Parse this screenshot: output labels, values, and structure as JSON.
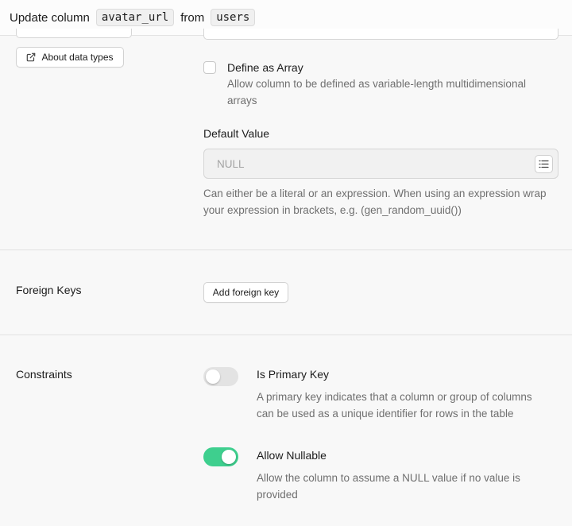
{
  "header": {
    "prefix": "Update column",
    "column": "avatar_url",
    "middle": "from",
    "table": "users"
  },
  "data_types": {
    "about_label": "About data types",
    "about_icon": "external-link-icon"
  },
  "array": {
    "label": "Define as Array",
    "description_line1": "Allow column to be defined as variable-length multidimensional",
    "description_line2": "arrays",
    "checked": false
  },
  "default_value": {
    "label": "Default Value",
    "placeholder": "NULL",
    "list_icon": "list-icon",
    "help_line1": "Can either be a literal or an expression. When using an expression wrap",
    "help_line2": "your expression in brackets, e.g. (gen_random_uuid())"
  },
  "foreign_keys": {
    "title": "Foreign Keys",
    "add_label": "Add foreign key"
  },
  "constraints": {
    "title": "Constraints",
    "primary_key": {
      "label": "Is Primary Key",
      "description_line1": "A primary key indicates that a column or group of columns",
      "description_line2": "can be used as a unique identifier for rows in the table",
      "enabled": false
    },
    "nullable": {
      "label": "Allow Nullable",
      "description_line1": "Allow the column to assume a NULL value if no value is",
      "description_line2": "provided",
      "enabled": true
    }
  },
  "colors": {
    "accent": "#3ecf8e",
    "toggle_off": "#e3e3e3"
  }
}
